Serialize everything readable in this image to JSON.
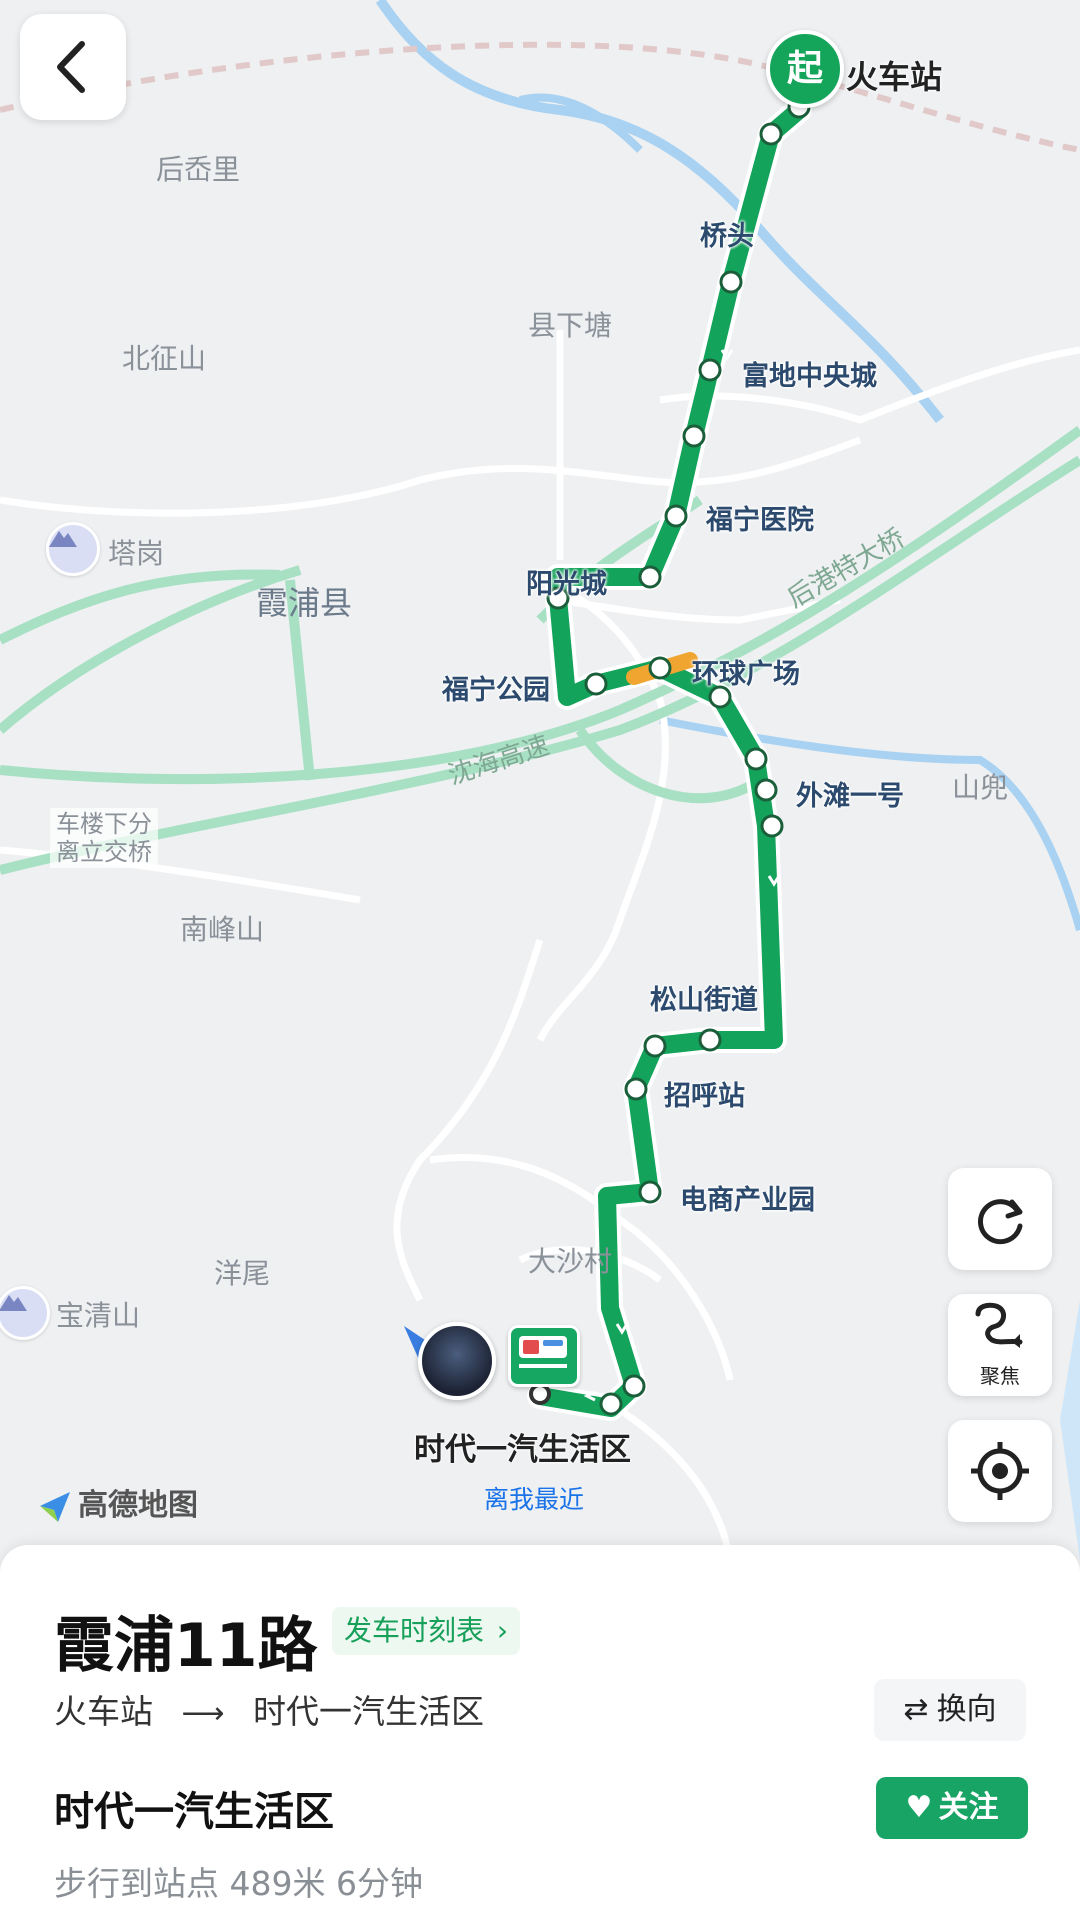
{
  "map": {
    "places": {
      "housongli": "后岙里",
      "xianxiatang": "县下塘",
      "beizhengshan": "北征山",
      "tagang": "塔岗",
      "xiapu_county": "霞浦县",
      "chelou_interchange_1": "车楼下分",
      "chelou_interchange_2": "离立交桥",
      "nanfengshan": "南峰山",
      "yangwei": "洋尾",
      "baoqingshan": "宝清山",
      "dasha": "大沙村",
      "shandou": "山兜"
    },
    "roads": {
      "shenhai_expressway": "沈海高速",
      "hougang_bridge": "后港特大桥"
    },
    "stops": {
      "start": "火车站",
      "qiaotou": "桥头",
      "fudi": "富地中央城",
      "funing_hospital": "福宁医院",
      "yangguangcheng": "阳光城",
      "funing_park": "福宁公园",
      "huanqiu": "环球广场",
      "waitan": "外滩一号",
      "songshan": "松山街道",
      "zhaohu": "招呼站",
      "dianshang": "电商产业园",
      "end": "时代一汽生活区"
    },
    "start_badge": "起",
    "nearest_label": "离我最近",
    "logo": "高德地图",
    "controls": {
      "focus_label": "聚焦"
    },
    "colors": {
      "route": "#13a35b",
      "congestion": "#f0a531",
      "road": "#a8e0c4"
    }
  },
  "sheet": {
    "route_name": "霞浦11路",
    "timetable_label": "发车时刻表",
    "direction_from": "火车站",
    "direction_to": "时代一汽生活区",
    "reverse_label": "换向",
    "current_stop": "时代一汽生活区",
    "follow_label": "关注",
    "walk_info": "步行到站点 489米 6分钟"
  }
}
